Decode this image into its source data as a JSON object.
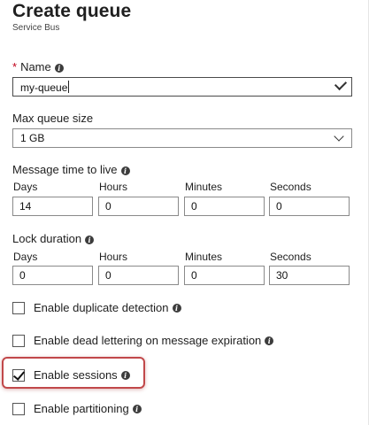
{
  "header": {
    "title": "Create queue",
    "subtitle": "Service Bus"
  },
  "name": {
    "required_mark": "*",
    "label": "Name",
    "value": "my-queue"
  },
  "max_size": {
    "label": "Max queue size",
    "selected": "1 GB"
  },
  "ttl": {
    "label": "Message time to live",
    "columns": [
      "Days",
      "Hours",
      "Minutes",
      "Seconds"
    ],
    "values": [
      "14",
      "0",
      "0",
      "0"
    ]
  },
  "lock": {
    "label": "Lock duration",
    "columns": [
      "Days",
      "Hours",
      "Minutes",
      "Seconds"
    ],
    "values": [
      "0",
      "0",
      "0",
      "30"
    ]
  },
  "options": [
    {
      "label": "Enable duplicate detection",
      "checked": false
    },
    {
      "label": "Enable dead lettering on message expiration",
      "checked": false
    },
    {
      "label": "Enable sessions",
      "checked": true
    },
    {
      "label": "Enable partitioning",
      "checked": false
    }
  ],
  "colors": {
    "required": "#c0001a",
    "highlight": "#c1484a"
  }
}
